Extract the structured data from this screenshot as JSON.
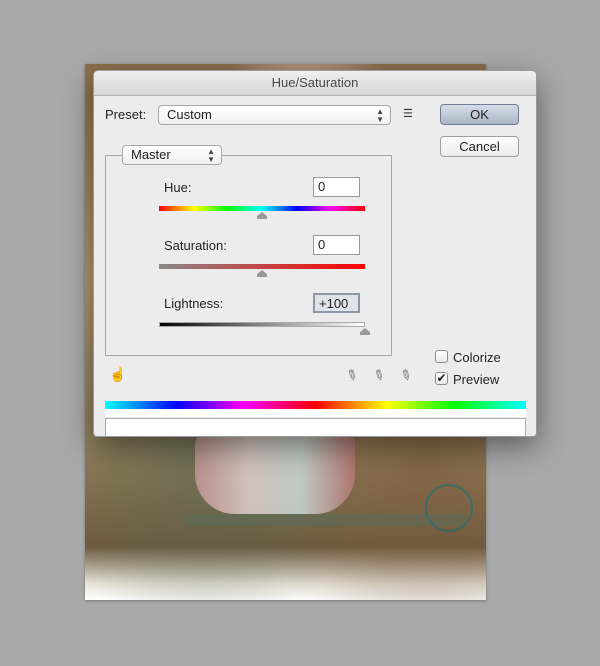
{
  "dialog": {
    "title": "Hue/Saturation",
    "preset_label": "Preset:",
    "preset_value": "Custom",
    "preset_options_icon": "list-options-icon",
    "ok_label": "OK",
    "cancel_label": "Cancel",
    "channel_value": "Master",
    "sliders": [
      {
        "label": "Hue:",
        "value": "0",
        "numeric": 0,
        "min": -180,
        "max": 180
      },
      {
        "label": "Saturation:",
        "value": "0",
        "numeric": 0,
        "min": -100,
        "max": 100
      },
      {
        "label": "Lightness:",
        "value": "+100",
        "numeric": 100,
        "min": -100,
        "max": 100
      }
    ],
    "colorize_label": "Colorize",
    "colorize_checked": false,
    "preview_label": "Preview",
    "preview_checked": true,
    "icons": [
      "targeted-adjustment-hand-icon",
      "eyedropper-icon",
      "eyedropper-plus-icon",
      "eyedropper-minus-icon"
    ]
  }
}
